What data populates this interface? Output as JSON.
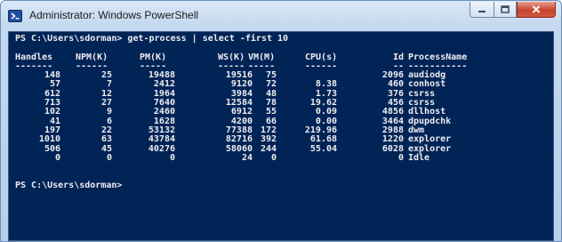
{
  "window": {
    "title": "Administrator: Windows PowerShell",
    "icon": "powershell-icon",
    "buttons": {
      "minimize": "minimize-icon",
      "maximize": "maximize-icon",
      "close": "close-icon"
    }
  },
  "colors": {
    "console_background": "#012456",
    "console_text": "#eeedf0",
    "close_button": "#c7432d"
  },
  "console": {
    "command_line": "PS C:\\Users\\sdorman> get-process | select -first 10",
    "headers": [
      "Handles",
      "NPM(K)",
      "PM(K)",
      "WS(K)",
      "VM(M)",
      "CPU(s)",
      "Id",
      "ProcessName"
    ],
    "separators": [
      "-------",
      "------",
      "-----",
      "-----",
      "-----",
      "------",
      "--",
      "-----------"
    ],
    "rows": [
      {
        "handles": "148",
        "npm": "25",
        "pm": "19488",
        "ws": "19516",
        "vm": "75",
        "cpu": "",
        "id": "2096",
        "name": "audiodg"
      },
      {
        "handles": "57",
        "npm": "7",
        "pm": "2412",
        "ws": "9120",
        "vm": "72",
        "cpu": "8.38",
        "id": "460",
        "name": "conhost"
      },
      {
        "handles": "612",
        "npm": "12",
        "pm": "1964",
        "ws": "3984",
        "vm": "48",
        "cpu": "1.73",
        "id": "376",
        "name": "csrss"
      },
      {
        "handles": "713",
        "npm": "27",
        "pm": "7640",
        "ws": "12584",
        "vm": "78",
        "cpu": "19.62",
        "id": "456",
        "name": "csrss"
      },
      {
        "handles": "102",
        "npm": "9",
        "pm": "2460",
        "ws": "6912",
        "vm": "55",
        "cpu": "0.09",
        "id": "4856",
        "name": "dllhost"
      },
      {
        "handles": "41",
        "npm": "6",
        "pm": "1628",
        "ws": "4200",
        "vm": "66",
        "cpu": "0.00",
        "id": "3464",
        "name": "dpupdchk"
      },
      {
        "handles": "197",
        "npm": "22",
        "pm": "53132",
        "ws": "77388",
        "vm": "172",
        "cpu": "219.96",
        "id": "2988",
        "name": "dwm"
      },
      {
        "handles": "1010",
        "npm": "63",
        "pm": "43784",
        "ws": "82716",
        "vm": "392",
        "cpu": "61.68",
        "id": "1220",
        "name": "explorer"
      },
      {
        "handles": "506",
        "npm": "45",
        "pm": "40276",
        "ws": "58060",
        "vm": "244",
        "cpu": "55.04",
        "id": "6028",
        "name": "explorer"
      },
      {
        "handles": "0",
        "npm": "0",
        "pm": "0",
        "ws": "24",
        "vm": "0",
        "cpu": "",
        "id": "0",
        "name": "Idle"
      }
    ],
    "prompt": "PS C:\\Users\\sdorman>"
  }
}
